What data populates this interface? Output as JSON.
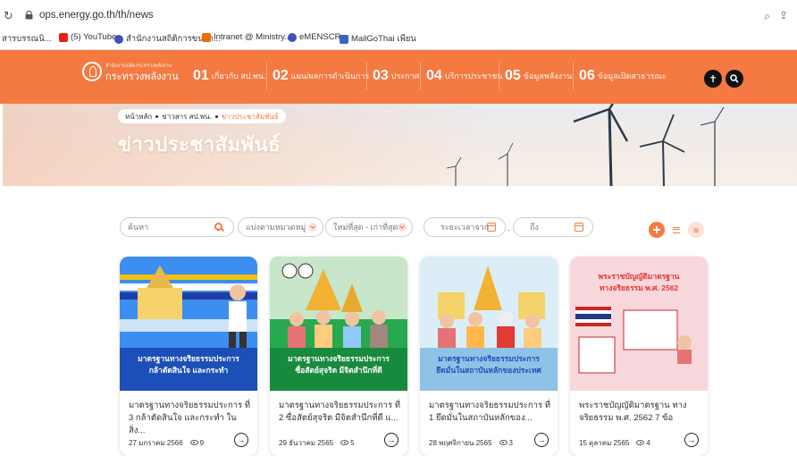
{
  "browser": {
    "url": "ops.energy.go.th/th/news",
    "bookmarks": [
      {
        "label": "สารบรรณนิ...",
        "color": "#ffffff"
      },
      {
        "label": "(5) YouTube",
        "color": "#e62117"
      },
      {
        "label": "สำนักงานสถิติการขนาก...",
        "color": "#3f51b5"
      },
      {
        "label": "Intranet @ Ministry...",
        "color": "#ef6c00"
      },
      {
        "label": "eMENSCR",
        "color": "#3f51b5"
      },
      {
        "label": "MailGoThai เพียน",
        "color": "#3a64c8"
      }
    ]
  },
  "nav": {
    "logo_line1": "สำนักงานปลัดกระทรวงพลังงาน",
    "logo_line2": "กระทรวงพลังงาน",
    "items": [
      {
        "num": "01",
        "label": "เกี่ยวกับ สป.พน."
      },
      {
        "num": "02",
        "label": "แผน/ผลการดำเนินการ"
      },
      {
        "num": "03",
        "label": "ประกาศ"
      },
      {
        "num": "04",
        "label": "บริการประชาชน"
      },
      {
        "num": "05",
        "label": "ข้อมูลพลังงาน"
      },
      {
        "num": "06",
        "label": "ข้อมูลเปิดสาธารณะ"
      }
    ]
  },
  "hero": {
    "breadcrumb": [
      "หน้าหลัก",
      "ข่าวสาร สป.พน.",
      "ข่าวประชาสัมพันธ์"
    ],
    "title": "ข่าวประชาสัมพันธ์"
  },
  "filters": {
    "search_placeholder": "ค้นหา",
    "category": "แบ่งตามหมวดหมู่",
    "sort": "ใหม่ที่สุด - เก่าที่สุด",
    "date_from": "ระยะเวลาจาก",
    "date_to": "ถึง",
    "dash": "-"
  },
  "cards": [
    {
      "thumb_text1": "มาตรฐานทางจริยธรรมประการ",
      "thumb_text2": "กล้าตัดสินใจ และกระทำ",
      "title": "มาตรฐานทางจริยธรรมประการ ที่ 3 กล้าตัดสินใจ และกระทำ ในสิ่ง...",
      "date": "27 มกราคม 2566",
      "views": "9"
    },
    {
      "thumb_text1": "มาตรฐานทางจริยธรรมประการ",
      "thumb_text2": "ซื่อสัตย์สุจริต มีจิตสำนึกที่ดี",
      "title": "มาตรฐานทางจริยธรรมประการ ที่ 2 ซื่อสัตย์สุจริต มีจิตสำนึกที่ดี แ...",
      "date": "29 ธันวาคม 2565",
      "views": "5"
    },
    {
      "thumb_text1": "มาตรฐานทางจริยธรรมประการ",
      "thumb_text2": "ยึดมั่นในสถาบันหลักของประเทศ",
      "title": "มาตรฐานทางจริยธรรมประการ ที่ 1 ยึดมั่นในสถาบันหลักของ...",
      "date": "28 พฤศจิกายน 2565",
      "views": "3"
    },
    {
      "thumb_text1": "พระราชบัญญัติมาตรฐาน",
      "thumb_text2": "ทางจริยธรรม พ.ศ. 2562",
      "title": "พระราชบัญญัติมาตรฐาน ทางจริยธรรม พ.ศ. 2562 7 ข้อ",
      "date": "15 ตุลาคม 2565",
      "views": "4"
    }
  ],
  "colors": {
    "accent": "#f47a41",
    "card1": "#2563c9",
    "card2": "#1fa04a",
    "card3": "#9ac9e6",
    "card4": "#f6c9cf"
  }
}
